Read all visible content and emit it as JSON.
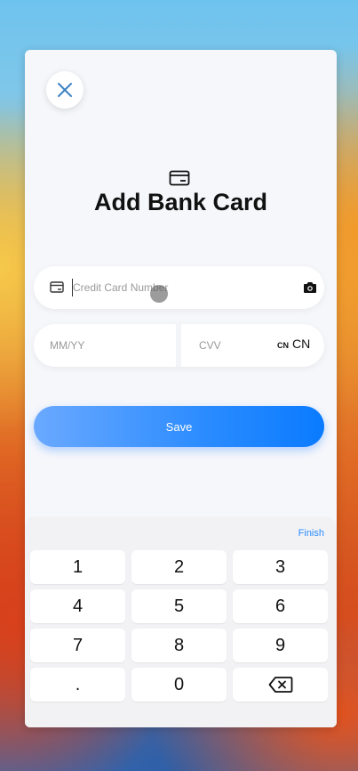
{
  "dialog": {
    "title": "Add Bank Card",
    "close_icon": "close-icon",
    "title_icon": "credit-card-icon"
  },
  "card_number": {
    "placeholder": "Credit Card Number",
    "value": "",
    "leading_icon": "credit-card-icon",
    "trailing_icon": "camera-icon"
  },
  "expiry": {
    "placeholder": "MM/YY",
    "value": ""
  },
  "cvv": {
    "placeholder": "CVV",
    "value": ""
  },
  "country": {
    "code_small": "CN",
    "code": "CN"
  },
  "save": {
    "label": "Save"
  },
  "keyboard": {
    "finish_label": "Finish",
    "keys": [
      "1",
      "2",
      "3",
      "4",
      "5",
      "6",
      "7",
      "8",
      "9",
      ".",
      "0"
    ],
    "backspace_icon": "backspace-icon"
  },
  "colors": {
    "accent": "#2a8bff",
    "card_bg": "#f6f7fb",
    "keyboard_bg": "#f2f2f4"
  }
}
